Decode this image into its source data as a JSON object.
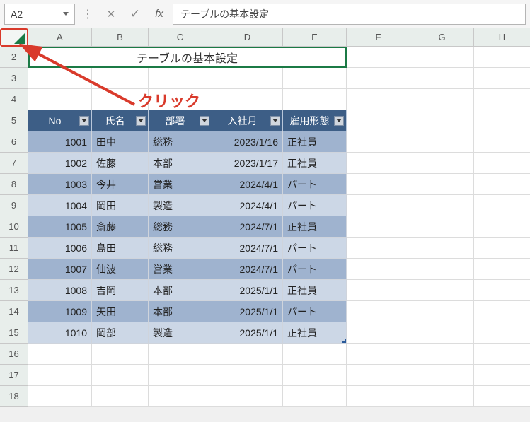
{
  "name_box": "A2",
  "formula_bar_value": "テーブルの基本設定",
  "annotation_text": "クリック",
  "columns": [
    "A",
    "B",
    "C",
    "D",
    "E",
    "F",
    "G",
    "H"
  ],
  "row_numbers": [
    2,
    3,
    4,
    5,
    6,
    7,
    8,
    9,
    10,
    11,
    12,
    13,
    14,
    15,
    16,
    17,
    18
  ],
  "title": "テーブルの基本設定",
  "table_headers": [
    "No",
    "氏名",
    "部署",
    "入社月",
    "雇用形態"
  ],
  "table_rows": [
    {
      "no": "1001",
      "name": "田中",
      "dept": "総務",
      "date": "2023/1/16",
      "type": "正社員"
    },
    {
      "no": "1002",
      "name": "佐藤",
      "dept": "本部",
      "date": "2023/1/17",
      "type": "正社員"
    },
    {
      "no": "1003",
      "name": "今井",
      "dept": "営業",
      "date": "2024/4/1",
      "type": "パート"
    },
    {
      "no": "1004",
      "name": "岡田",
      "dept": "製造",
      "date": "2024/4/1",
      "type": "パート"
    },
    {
      "no": "1005",
      "name": "斎藤",
      "dept": "総務",
      "date": "2024/7/1",
      "type": "正社員"
    },
    {
      "no": "1006",
      "name": "島田",
      "dept": "総務",
      "date": "2024/7/1",
      "type": "パート"
    },
    {
      "no": "1007",
      "name": "仙波",
      "dept": "営業",
      "date": "2024/7/1",
      "type": "パート"
    },
    {
      "no": "1008",
      "name": "吉岡",
      "dept": "本部",
      "date": "2025/1/1",
      "type": "正社員"
    },
    {
      "no": "1009",
      "name": "矢田",
      "dept": "本部",
      "date": "2025/1/1",
      "type": "パート"
    },
    {
      "no": "1010",
      "name": "岡部",
      "dept": "製造",
      "date": "2025/1/1",
      "type": "正社員"
    }
  ]
}
